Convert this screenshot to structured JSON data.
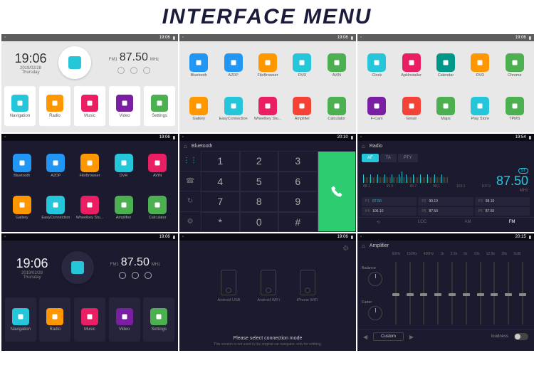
{
  "header": "INTERFACE MENU",
  "status_time": "19:06",
  "clock": {
    "time": "19:06",
    "date": "2019/02/28",
    "day": "Thursday"
  },
  "radio_widget": {
    "band": "FM1",
    "freq": "87.50",
    "unit": "MHz"
  },
  "home_apps": [
    {
      "label": "Navigation",
      "color": "c-cyan"
    },
    {
      "label": "Radio",
      "color": "c-orange"
    },
    {
      "label": "Music",
      "color": "c-pink"
    },
    {
      "label": "Video",
      "color": "c-purple"
    },
    {
      "label": "Settings",
      "color": "c-green"
    }
  ],
  "apps2": [
    {
      "label": "Bluetooth",
      "color": "c-blue"
    },
    {
      "label": "A2DP",
      "color": "c-blue"
    },
    {
      "label": "FileBrowser",
      "color": "c-orange"
    },
    {
      "label": "DVR",
      "color": "c-cyan"
    },
    {
      "label": "AVIN",
      "color": "c-green"
    },
    {
      "label": "Gallery",
      "color": "c-orange"
    },
    {
      "label": "EasyConnection",
      "color": "c-cyan"
    },
    {
      "label": "Wheelkey Stu...",
      "color": "c-pink"
    },
    {
      "label": "Amplifier",
      "color": "c-red"
    },
    {
      "label": "Calculator",
      "color": "c-green"
    }
  ],
  "apps3": [
    {
      "label": "Clock",
      "color": "c-cyan"
    },
    {
      "label": "ApkInstaller",
      "color": "c-pink"
    },
    {
      "label": "Calendar",
      "color": "c-dgreen"
    },
    {
      "label": "DVD",
      "color": "c-orange"
    },
    {
      "label": "Chrome",
      "color": "c-green"
    },
    {
      "label": "F-Cam",
      "color": "c-purple"
    },
    {
      "label": "Gmail",
      "color": "c-red"
    },
    {
      "label": "Maps",
      "color": "c-green"
    },
    {
      "label": "Play Store",
      "color": "c-cyan"
    },
    {
      "label": "TPMS",
      "color": "c-green"
    }
  ],
  "apps4": [
    {
      "label": "Bluetooth",
      "color": "c-blue"
    },
    {
      "label": "A2DP",
      "color": "c-blue"
    },
    {
      "label": "FileBrowser",
      "color": "c-orange"
    },
    {
      "label": "DVR",
      "color": "c-cyan"
    },
    {
      "label": "AVIN",
      "color": "c-pink"
    },
    {
      "label": "Gallery",
      "color": "c-orange"
    },
    {
      "label": "EasyConnection",
      "color": "c-cyan"
    },
    {
      "label": "Wheelkey Stu...",
      "color": "c-pink"
    },
    {
      "label": "Amplifier",
      "color": "c-green"
    },
    {
      "label": "Calculator",
      "color": "c-green"
    }
  ],
  "dialer": {
    "title": "Bluetooth",
    "time": "20:10",
    "keys": [
      "1",
      "2",
      "3",
      "4",
      "5",
      "6",
      "7",
      "8",
      "9",
      "*",
      "0",
      "#"
    ]
  },
  "radio": {
    "title": "Radio",
    "time": "19:54",
    "tabs": [
      "AF",
      "TA",
      "PTY"
    ],
    "scale": [
      "88.1",
      "91.5",
      "95.7",
      "98.1",
      "103.1",
      "107.9"
    ],
    "freq": "87.50",
    "unit": "MHz",
    "st": "ST",
    "presets": [
      {
        "n": "P1",
        "v": "87.50",
        "active": true
      },
      {
        "n": "P2",
        "v": "90.10"
      },
      {
        "n": "P3",
        "v": "98.10"
      },
      {
        "n": "P4",
        "v": "106.10"
      },
      {
        "n": "P5",
        "v": "87.50"
      },
      {
        "n": "P6",
        "v": "87.50"
      }
    ],
    "bottom": [
      "⟲",
      "LOC",
      "AM",
      "FM"
    ]
  },
  "home_dark_time": "19:06",
  "connection": {
    "phones": [
      "Android USB",
      "Android WiFi",
      "iPhone WiFi"
    ],
    "title": "Please select connection mode",
    "sub": "This version is not used in the original car navigator, only for refitting."
  },
  "amp": {
    "title": "Amplifier",
    "time": "20:15",
    "freqs": [
      "60Hz",
      "150Hz",
      "400Hz",
      "1k",
      "2.5k",
      "6k",
      "10k",
      "12.5k",
      "15k",
      "SUB"
    ],
    "side": [
      "Balance",
      "Fader"
    ],
    "custom": "Custom",
    "loud": "loudness",
    "thumbs": [
      50,
      50,
      50,
      50,
      50,
      50,
      50,
      50,
      50,
      50
    ]
  }
}
